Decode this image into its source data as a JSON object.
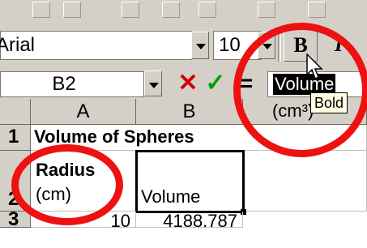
{
  "toolbar": {
    "font_name": "Arial",
    "font_size": "10",
    "bold_label": "B",
    "italic_label": "I",
    "bold_tooltip": "Bold"
  },
  "formula_bar": {
    "name_box": "B2",
    "cancel_symbol": "✕",
    "enter_symbol": "✓",
    "equals_symbol": "=",
    "content_line1": "Volume",
    "content_line2": "(cm³)"
  },
  "grid": {
    "columns": [
      "A",
      "B"
    ],
    "rows": [
      "1",
      "2",
      "3"
    ],
    "cells": {
      "A1": "Volume of Spheres",
      "A2_line1": "Radius",
      "A2_line2": "(cm)",
      "B2": "Volume",
      "A3": "10",
      "B3": "4188.787"
    }
  },
  "colors": {
    "highlight_ring": "#ee1111",
    "toolbar_bg": "#d4d0c8",
    "tooltip_bg": "#ffffe1"
  }
}
